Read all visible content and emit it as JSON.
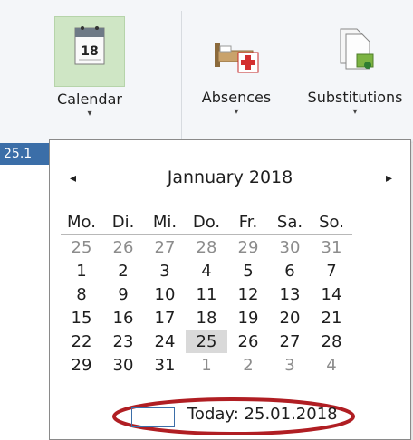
{
  "ribbon": {
    "calendar_label": "Calendar",
    "absences_label": "Absences",
    "substitutions_label": "Substitutions",
    "dropdown_arrow": "▾",
    "calendar_icon_text": "18"
  },
  "date_field": {
    "value": "25.1"
  },
  "calendar": {
    "prev": "◂",
    "next": "▸",
    "month_year": "Jannuary  2018",
    "weekdays": [
      "Mo.",
      "Di.",
      "Mi.",
      "Do.",
      "Fr.",
      "Sa.",
      "So."
    ],
    "weeks": [
      [
        {
          "d": "25",
          "m": 1
        },
        {
          "d": "26",
          "m": 1
        },
        {
          "d": "27",
          "m": 1
        },
        {
          "d": "28",
          "m": 1
        },
        {
          "d": "29",
          "m": 1
        },
        {
          "d": "30",
          "m": 1
        },
        {
          "d": "31",
          "m": 1
        }
      ],
      [
        {
          "d": "1"
        },
        {
          "d": "2"
        },
        {
          "d": "3"
        },
        {
          "d": "4"
        },
        {
          "d": "5"
        },
        {
          "d": "6"
        },
        {
          "d": "7"
        }
      ],
      [
        {
          "d": "8"
        },
        {
          "d": "9"
        },
        {
          "d": "10"
        },
        {
          "d": "11"
        },
        {
          "d": "12"
        },
        {
          "d": "13"
        },
        {
          "d": "14"
        }
      ],
      [
        {
          "d": "15"
        },
        {
          "d": "16"
        },
        {
          "d": "17"
        },
        {
          "d": "18"
        },
        {
          "d": "19"
        },
        {
          "d": "20"
        },
        {
          "d": "21"
        }
      ],
      [
        {
          "d": "22"
        },
        {
          "d": "23"
        },
        {
          "d": "24"
        },
        {
          "d": "25",
          "sel": 1
        },
        {
          "d": "26"
        },
        {
          "d": "27"
        },
        {
          "d": "28"
        }
      ],
      [
        {
          "d": "29"
        },
        {
          "d": "30"
        },
        {
          "d": "31"
        },
        {
          "d": "1",
          "m": 1
        },
        {
          "d": "2",
          "m": 1
        },
        {
          "d": "3",
          "m": 1
        },
        {
          "d": "4",
          "m": 1
        }
      ]
    ],
    "today_label": "Today: 25.01.2018",
    "highlight_color": "#b01e23"
  }
}
